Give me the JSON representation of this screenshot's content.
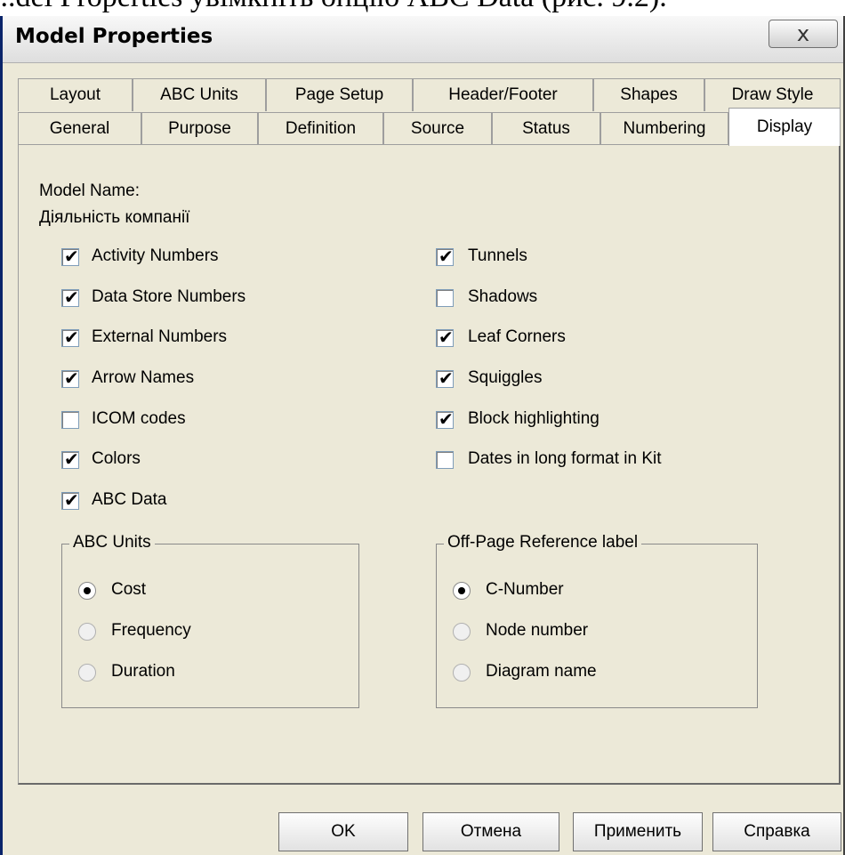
{
  "background_text": "...del Properties увімкніть опцію ABC Data (рис. 9.2).",
  "dialog": {
    "title": "Model Properties",
    "close_glyph": "x"
  },
  "tabs_row1": [
    "Layout",
    "ABC Units",
    "Page Setup",
    "Header/Footer",
    "Shapes",
    "Draw Style"
  ],
  "tabs_row2": [
    "General",
    "Purpose",
    "Definition",
    "Source",
    "Status",
    "Numbering",
    "Display"
  ],
  "active_tab": "Display",
  "model_name_label": "Model Name:",
  "model_name_value": "Діяльність компанії",
  "left_options": [
    {
      "label": "Activity Numbers",
      "checked": true
    },
    {
      "label": "Data Store Numbers",
      "checked": true
    },
    {
      "label": "External Numbers",
      "checked": true
    },
    {
      "label": "Arrow Names",
      "checked": true
    },
    {
      "label": "ICOM codes",
      "checked": false
    },
    {
      "label": "Colors",
      "checked": true
    },
    {
      "label": "ABC Data",
      "checked": true
    }
  ],
  "right_options": [
    {
      "label": "Tunnels",
      "checked": true
    },
    {
      "label": "Shadows",
      "checked": false
    },
    {
      "label": "Leaf Corners",
      "checked": true
    },
    {
      "label": "Squiggles",
      "checked": true
    },
    {
      "label": "Block highlighting",
      "checked": true
    },
    {
      "label": "Dates in long format in Kit",
      "checked": false
    }
  ],
  "abc_units_group": {
    "title": "ABC Units",
    "options": [
      {
        "label": "Cost",
        "selected": true
      },
      {
        "label": "Frequency",
        "selected": false
      },
      {
        "label": "Duration",
        "selected": false
      }
    ]
  },
  "offpage_group": {
    "title": "Off-Page Reference label",
    "options": [
      {
        "label": "C-Number",
        "selected": true
      },
      {
        "label": "Node number",
        "selected": false
      },
      {
        "label": "Diagram name",
        "selected": false
      }
    ]
  },
  "buttons": {
    "ok": "OK",
    "cancel": "Отмена",
    "apply": "Применить",
    "help": "Справка"
  },
  "check_glyph": "✔"
}
